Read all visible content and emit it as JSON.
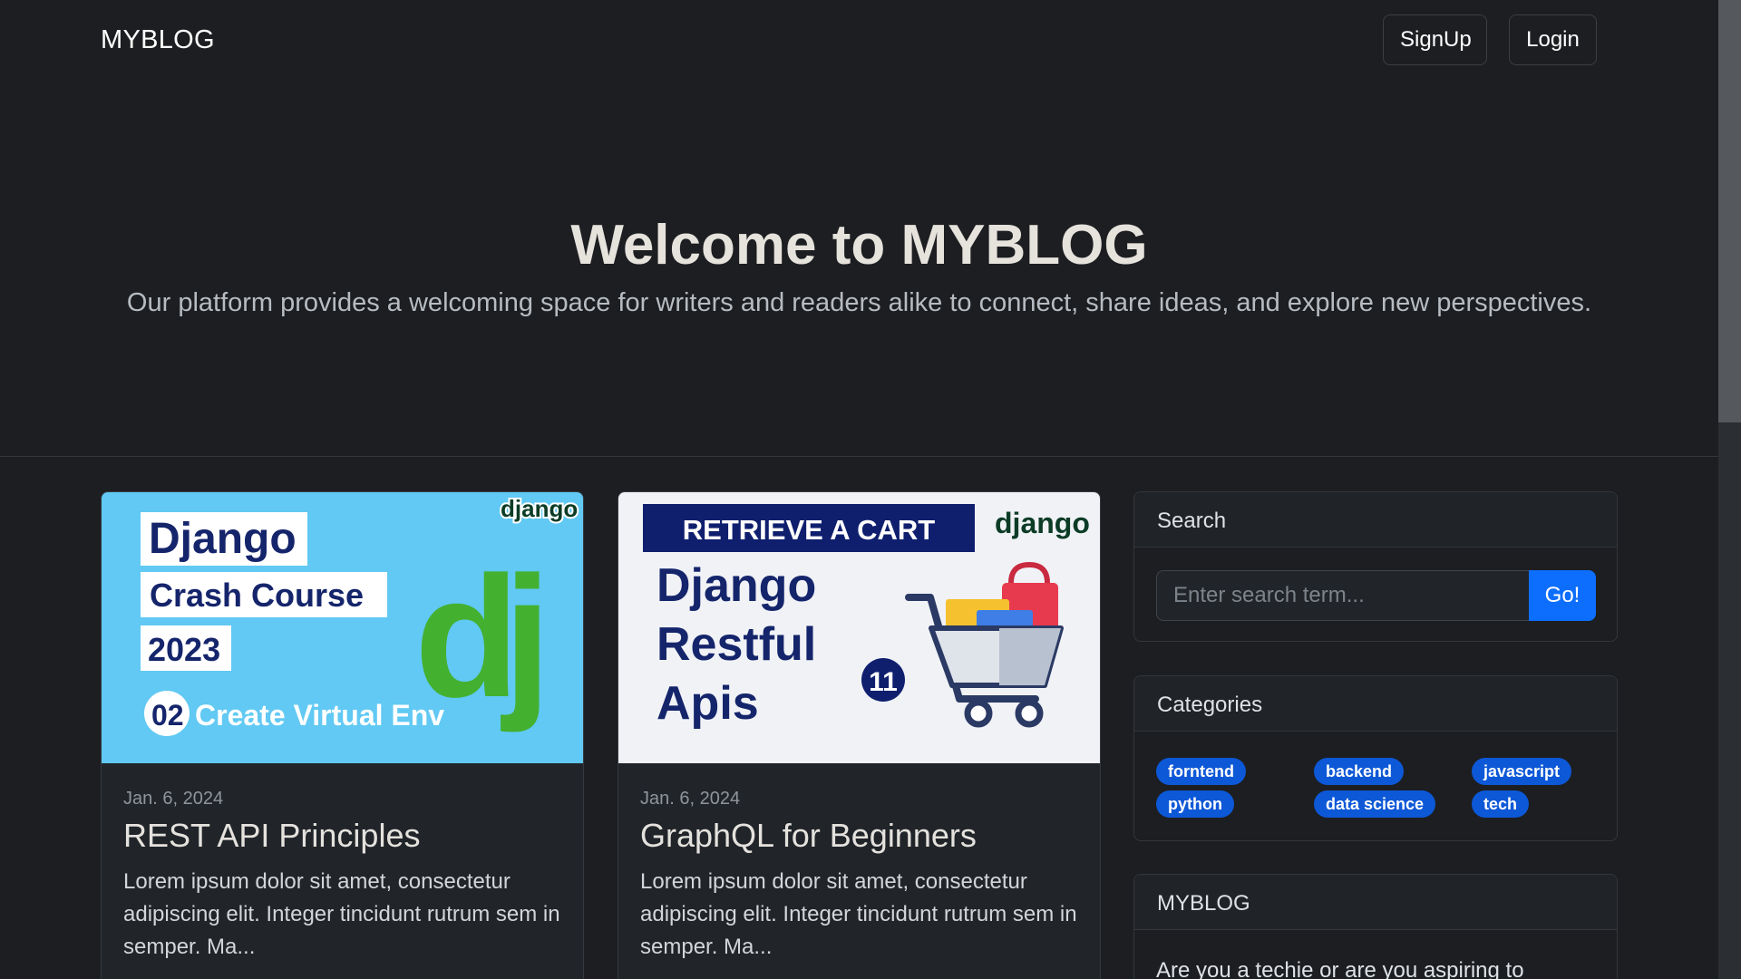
{
  "navbar": {
    "brand": "MYBLOG",
    "signup_label": "SignUp",
    "login_label": "Login"
  },
  "hero": {
    "title": "Welcome to MYBLOG",
    "subtitle": "Our platform provides a welcoming space for writers and readers alike to connect, share ideas, and explore new perspectives."
  },
  "posts": [
    {
      "image": {
        "label_1": "Django",
        "label_2": "Crash Course",
        "label_3": "2023",
        "episode": "02",
        "caption": "Create Virtual Env",
        "logo": "django",
        "monogram": "dj",
        "bg_color": "#61c9f3"
      },
      "date": "Jan. 6, 2024",
      "title": "REST API Principles",
      "excerpt": "Lorem ipsum dolor sit amet, consectetur adipiscing elit. Integer tincidunt rutrum sem in semper. Ma..."
    },
    {
      "image": {
        "banner": "RETRIEVE A CART",
        "line_1": "Django",
        "line_2": "Restful",
        "line_3": "Apis",
        "episode": "11",
        "logo": "django",
        "bg_color": "#f0f2f6"
      },
      "date": "Jan. 6, 2024",
      "title": "GraphQL for Beginners",
      "excerpt": "Lorem ipsum dolor sit amet, consectetur adipiscing elit. Integer tincidunt rutrum sem in semper. Ma..."
    }
  ],
  "sidebar": {
    "search": {
      "heading": "Search",
      "placeholder": "Enter search term...",
      "button_label": "Go!"
    },
    "categories": {
      "heading": "Categories",
      "tags": [
        "forntend",
        "backend",
        "javascript",
        "python",
        "data science",
        "tech"
      ]
    },
    "about": {
      "heading": "MYBLOG",
      "text": "Are you a techie or are you aspiring to"
    }
  },
  "colors": {
    "background": "#1c1e21",
    "accent": "#0d6efd",
    "tag": "#0d58d7"
  }
}
